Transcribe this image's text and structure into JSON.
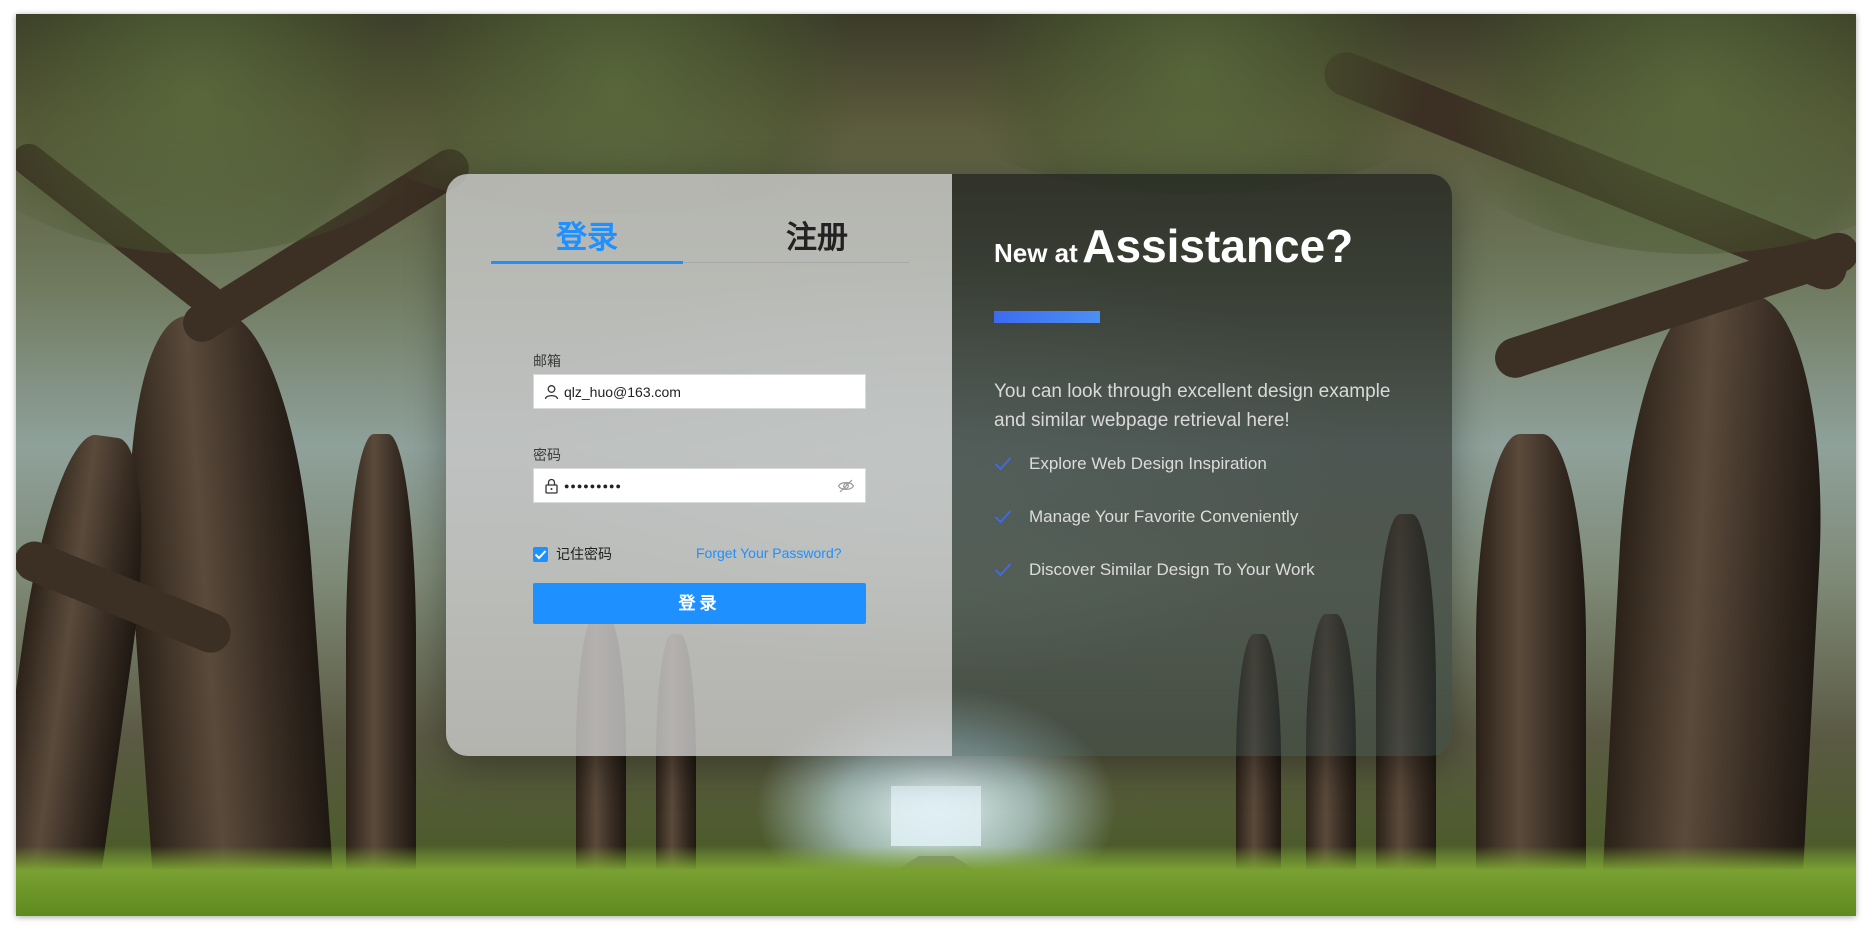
{
  "tabs": {
    "login": "登录",
    "register": "注册"
  },
  "form": {
    "email_label": "邮箱",
    "email_value": "qlz_huo@163.com",
    "password_label": "密码",
    "password_value": "●●●●●●●●●",
    "remember_label": "记住密码",
    "remember_checked": true,
    "forgot_link": "Forget Your Password?",
    "submit_label": "登录"
  },
  "promo": {
    "title_prefix": "New at",
    "title_main": "Assistance?",
    "description": "You can look through excellent design example and similar webpage retrieval here!",
    "features": [
      "Explore Web Design Inspiration",
      "Manage Your Favorite Conveniently",
      "Discover Similar Design To Your Work"
    ]
  },
  "colors": {
    "accent": "#1e90ff",
    "accent_bar": "#3d6bf0",
    "check": "#2f6bf0"
  },
  "icons": [
    "user-icon",
    "lock-icon",
    "eye-off-icon",
    "checkbox-check-icon",
    "check-icon"
  ]
}
